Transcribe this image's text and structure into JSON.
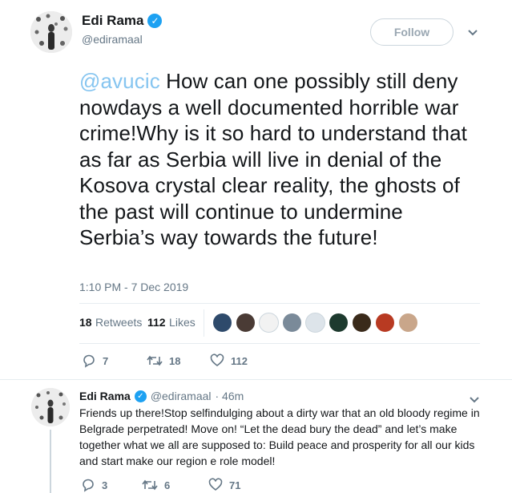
{
  "tweet": {
    "author_name": "Edi Rama",
    "author_handle": "@ediramaal",
    "follow_label": "Follow",
    "mention": "@avucic",
    "text": " How can one possibly still deny nowdays a well documented horrible war crime!Why is it so hard to understand that as far as Serbia will live in denial of the Kosova crystal clear reality, the ghosts of the past will continue to undermine Serbia’s way towards the future!",
    "timestamp": "1:10 PM - 7 Dec 2019",
    "retweets_count": "18",
    "retweets_label": "Retweets",
    "likes_count": "112",
    "likes_label": "Likes",
    "liker_avatars": [
      "#2e4a6b",
      "#4a3b35",
      "#f2f2f2",
      "#7a8a99",
      "#dde4ea",
      "#1d3a2e",
      "#3a2a1a",
      "#b83a22",
      "#c9a68a"
    ],
    "actions": {
      "replies": "7",
      "retweets": "18",
      "likes": "112"
    }
  },
  "reply": {
    "author_name": "Edi Rama",
    "author_handle": "@ediramaal",
    "age": "· 46m",
    "text": "Friends up there!Stop selfindulging about a dirty war that an old bloody regime in Belgrade perpetrated! Move on! “Let the dead bury the dead” and let’s make together what we all are supposed to: Build peace and prosperity for all our kids and start make our region e role model!",
    "actions": {
      "replies": "3",
      "retweets": "6",
      "likes": "71"
    }
  },
  "colors": {
    "accent": "#1da1f2",
    "mention": "#86c5f0",
    "muted": "#657786"
  }
}
